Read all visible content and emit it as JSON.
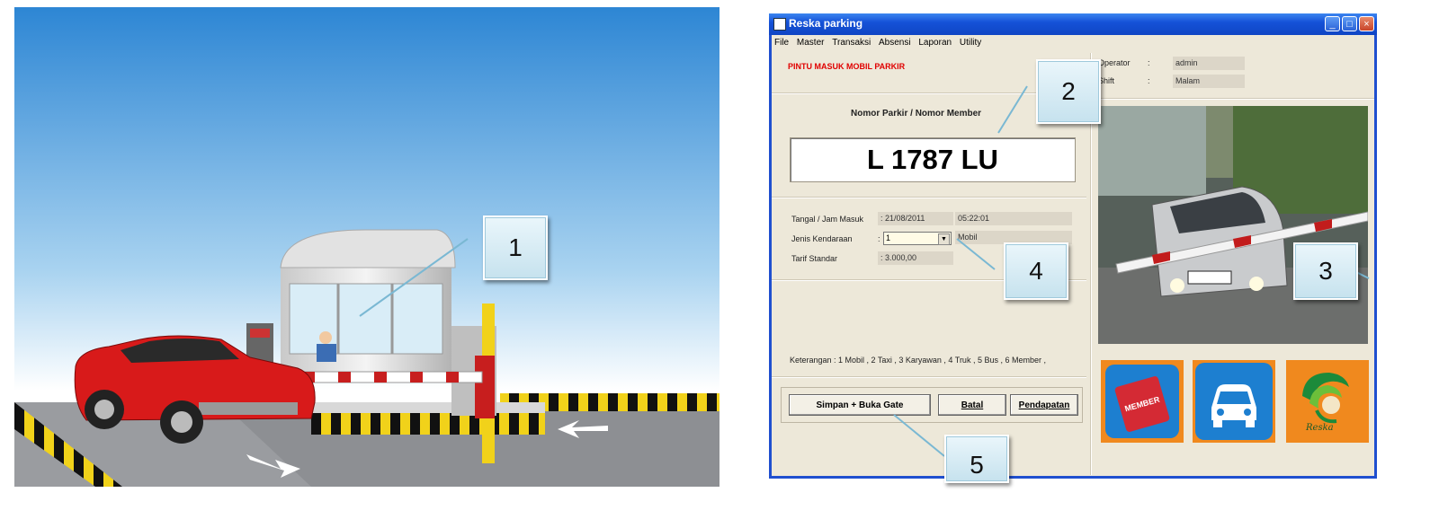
{
  "callouts": [
    "1",
    "2",
    "3",
    "4",
    "5"
  ],
  "window": {
    "title": "Reska parking",
    "menu": [
      "File",
      "Master",
      "Transaksi",
      "Absensi",
      "Laporan",
      "Utility"
    ]
  },
  "header": {
    "gate_title": "PINTU MASUK MOBIL PARKIR",
    "operator_label": "Operator",
    "operator_value": "admin",
    "shift_label": "Shift",
    "shift_value": "Malam",
    "colon": ":"
  },
  "entry": {
    "plate_label": "Nomor Parkir / Nomor Member",
    "plate_value": "L 1787 LU"
  },
  "details": {
    "date_label": "Tangal / Jam Masuk",
    "date_value": ": 21/08/2011",
    "time_value": "05:22:01",
    "type_label": "Jenis Kendaraan",
    "type_prefix": ":",
    "type_value": "1",
    "type_name": "Mobil",
    "tariff_label": "Tarif Standar",
    "tariff_value": ": 3.000,00"
  },
  "note": "Keterangan :  1 Mobil , 2 Taxi , 3 Karyawan , 4 Truk , 5 Bus , 6 Member ,",
  "buttons": {
    "save_open": "Simpan + Buka Gate",
    "cancel": "Batal",
    "income": "Pendapatan"
  },
  "tiles": {
    "member": "MEMBER",
    "logo_text": "Reska"
  },
  "colors": {
    "titlebar": "#1552d8",
    "gate_title": "#e00000",
    "tile_orange": "#f0891e",
    "tile_blue": "#1d7fd0"
  }
}
